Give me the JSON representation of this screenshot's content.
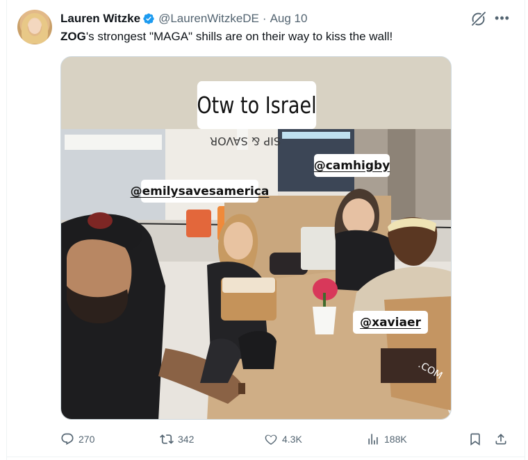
{
  "author": {
    "name": "Lauren Witzke",
    "handle": "@LaurenWitzkeDE",
    "separator": "·",
    "date": "Aug 10"
  },
  "tweet": {
    "text_bold": "ZOG",
    "text_rest": "'s strongest \"MAGA\" shills are on their way to kiss the wall!"
  },
  "media": {
    "caption": "Otw to Israel",
    "tags": [
      "@emilysavesamerica",
      "@camhigby",
      "@xaviaer"
    ],
    "shop_sign": "SIP & SAVOR",
    "bag_print": ".COM"
  },
  "actions": {
    "replies": "270",
    "reposts": "342",
    "likes": "4.3K",
    "views": "188K"
  },
  "icons": {
    "verified": "verified-badge-icon",
    "grok": "grok-icon",
    "more": "more-icon",
    "reply": "reply-icon",
    "repost": "repost-icon",
    "like": "heart-icon",
    "views": "views-icon",
    "bookmark": "bookmark-icon",
    "share": "share-icon"
  },
  "colors": {
    "verified": "#1d9bf0",
    "secondary_text": "#536471",
    "primary_text": "#0f1419",
    "border": "#cfd9de"
  }
}
